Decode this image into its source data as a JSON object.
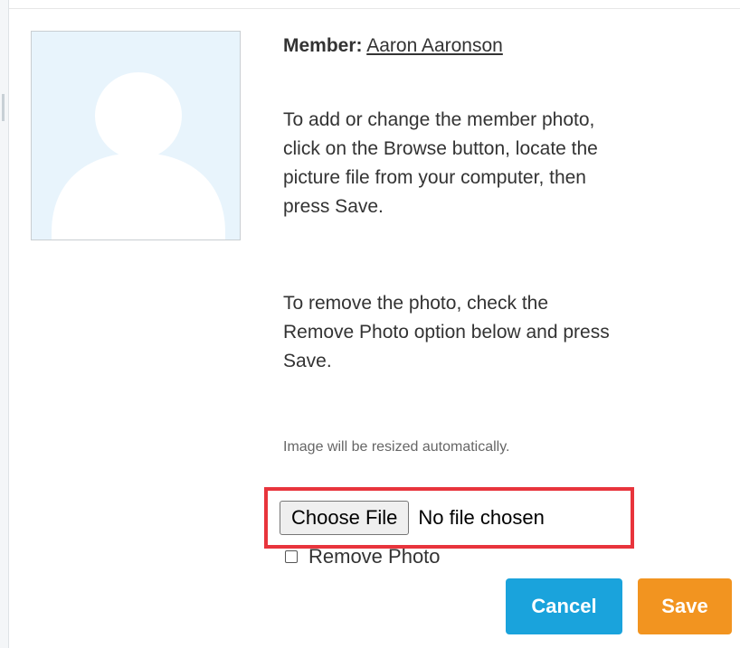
{
  "member": {
    "label": "Member:",
    "name": "Aaron Aaronson"
  },
  "instructions": {
    "add_change_lines": [
      "To add or change the member photo,",
      "click on the Browse button, locate the",
      "picture file from your computer, then",
      "press Save."
    ],
    "remove_lines": [
      "To remove the photo, check the",
      "Remove Photo option below and press",
      "Save."
    ],
    "resize_note": "Image will be resized automatically."
  },
  "file_input": {
    "button_label": "Choose File",
    "status_text": "No file chosen"
  },
  "remove_photo": {
    "label": "Remove Photo",
    "checked": false
  },
  "buttons": {
    "cancel_label": "Cancel",
    "save_label": "Save"
  },
  "colors": {
    "photo_background": "#e8f4fc",
    "avatar_silhouette": "#ffffff",
    "cancel_button": "#1aa3dc",
    "save_button": "#f29420",
    "highlight_border": "#e8343c"
  },
  "icons": {
    "avatar": "default-avatar-silhouette"
  }
}
